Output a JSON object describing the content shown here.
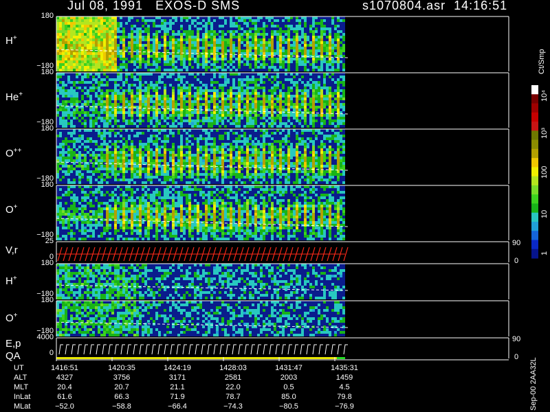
{
  "header": {
    "title": "Jul 08, 1991   EXOS-D SMS",
    "file_time": "s1070804.asr  14:16:51"
  },
  "panels": [
    {
      "id": "h-plus",
      "label": "H",
      "sup": "+",
      "top_tick": "180",
      "bottom_tick": "−180"
    },
    {
      "id": "he-plus",
      "label": "He",
      "sup": "+",
      "top_tick": "180",
      "bottom_tick": "−180"
    },
    {
      "id": "o-plus-plus",
      "label": "O",
      "sup": "++",
      "top_tick": "180",
      "bottom_tick": "−180"
    },
    {
      "id": "o-plus",
      "label": "O",
      "sup": "+",
      "top_tick": "180",
      "bottom_tick": "−180"
    },
    {
      "id": "vr",
      "label": "V,r",
      "sup": "",
      "top_tick": "25",
      "bottom_tick": "0",
      "right_top": "90",
      "right_bottom": "0"
    },
    {
      "id": "h-plus-2",
      "label": "H",
      "sup": "+",
      "top_tick": "180",
      "bottom_tick": "−180"
    },
    {
      "id": "o-plus-2",
      "label": "O",
      "sup": "+",
      "top_tick": "180",
      "bottom_tick": "−180"
    },
    {
      "id": "ep-qa",
      "label": "E,p",
      "sup": "",
      "label2": "QA",
      "top_tick": "4000",
      "bottom_tick": "0",
      "right_top": "90",
      "right_bottom": "0"
    }
  ],
  "colorbar": {
    "units": "Ct/Smp",
    "ticks": [
      "1",
      "10",
      "100",
      "10³",
      "10⁴"
    ],
    "colors": [
      "#06148c",
      "#0a28c8",
      "#1464dc",
      "#20a0d8",
      "#28c8c0",
      "#18b418",
      "#3cd21e",
      "#78dc28",
      "#b4e61e",
      "#f0f000",
      "#f0c800",
      "#b4a000",
      "#8c8c00",
      "#6e7800",
      "#c81414",
      "#c80000",
      "#a00000",
      "#780000",
      "#ffffff"
    ]
  },
  "footer": {
    "rows": [
      {
        "label": "UT",
        "values": [
          "1416:51",
          "1420:35",
          "1424:19",
          "1428:03",
          "1431:47",
          "1435:31"
        ]
      },
      {
        "label": "ALT",
        "values": [
          "4327",
          "3756",
          "3171",
          "2581",
          "2003",
          "1459"
        ]
      },
      {
        "label": "MLT",
        "values": [
          "20.4",
          "20.7",
          "21.1",
          "22.0",
          "0.5",
          "4.5"
        ]
      },
      {
        "label": "InLat",
        "values": [
          "61.6",
          "66.3",
          "71.9",
          "78.7",
          "85.0",
          "79.8"
        ]
      },
      {
        "label": "MLat",
        "values": [
          "−52.0",
          "−58.8",
          "−66.4",
          "−74.3",
          "−80.5",
          "−76.9"
        ]
      }
    ],
    "side_id": "Sep-00 2AA32L"
  },
  "chart_data": {
    "type": "heatmap",
    "title": "Jul 08, 1991   EXOS-D SMS",
    "x_ticks": [
      "1416:51",
      "1420:35",
      "1424:19",
      "1428:03",
      "1431:47",
      "1435:31"
    ],
    "panels": [
      "H+",
      "He+",
      "O++",
      "O+",
      "V,r",
      "H+",
      "O+",
      "E,p / QA"
    ],
    "ylim_pitch": [
      -180,
      180
    ],
    "colorbar_range": [
      1,
      10000
    ],
    "colorbar_scale": "log",
    "colorbar_units": "Ct/Smp",
    "grid": false
  }
}
